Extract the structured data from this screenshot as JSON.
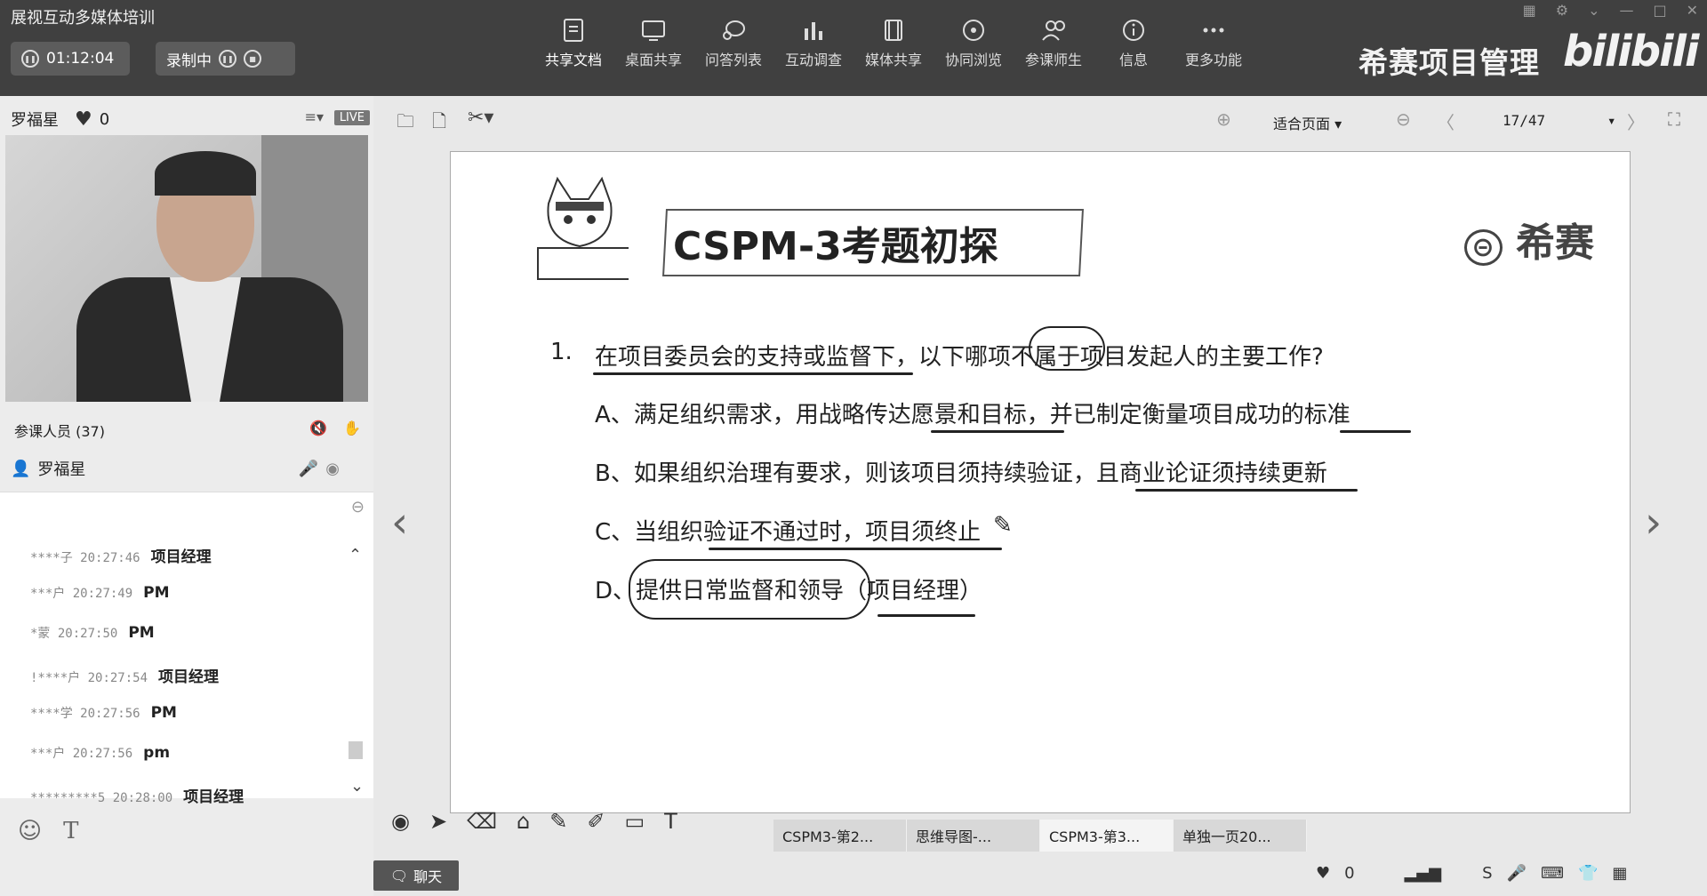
{
  "app": {
    "title": "展视互动多媒体培训"
  },
  "session": {
    "timer": "01:12:04",
    "rec_label": "录制中"
  },
  "toolbar": {
    "items": [
      {
        "label": "共享文档",
        "icon": "document-icon"
      },
      {
        "label": "桌面共享",
        "icon": "desktop-icon"
      },
      {
        "label": "问答列表",
        "icon": "qa-icon"
      },
      {
        "label": "互动调查",
        "icon": "chart-icon"
      },
      {
        "label": "媒体共享",
        "icon": "film-icon"
      },
      {
        "label": "协同浏览",
        "icon": "compass-icon"
      },
      {
        "label": "参课师生",
        "icon": "people-icon"
      },
      {
        "label": "信息",
        "icon": "info-icon"
      },
      {
        "label": "更多功能",
        "icon": "more-icon"
      }
    ]
  },
  "brand": {
    "name": "希赛项目管理",
    "bili": "bilibili"
  },
  "presenter": {
    "name": "罗福星",
    "likes": "0",
    "live": "LIVE"
  },
  "attendees": {
    "header": "参课人员 (37)",
    "first": "罗福星"
  },
  "chat": {
    "messages": [
      {
        "user": "****子",
        "time": "20:27:46",
        "text": "项目经理"
      },
      {
        "user": "***户",
        "time": "20:27:49",
        "text": "PM"
      },
      {
        "user": "*蒙",
        "time": "20:27:50",
        "text": "PM"
      },
      {
        "user": "!****户",
        "time": "20:27:54",
        "text": "项目经理"
      },
      {
        "user": "****学",
        "time": "20:27:56",
        "text": "PM"
      },
      {
        "user": "***户",
        "time": "20:27:56",
        "text": "pm"
      },
      {
        "user": "*********5",
        "time": "20:28:00",
        "text": "项目经理"
      }
    ],
    "tab_label": "聊天"
  },
  "doc": {
    "fit_label": "适合页面",
    "page": "17/47"
  },
  "slide": {
    "title": "CSPM-3考题初探",
    "logo": "希赛",
    "question_num": "1.",
    "question": "在项目委员会的支持或监督下，以下哪项不属于项目发起人的主要工作?",
    "options": {
      "a": "A、满足组织需求，用战略传达愿景和目标，并已制定衡量项目成功的标准",
      "b": "B、如果组织治理有要求，则该项目须持续验证，且商业论证须持续更新",
      "c": "C、当组织验证不通过时，项目须终止",
      "d": "D、提供日常监督和领导（项目经理）"
    }
  },
  "tabs": [
    {
      "label": "CSPM3-第2..."
    },
    {
      "label": "思维导图-..."
    },
    {
      "label": "CSPM3-第3..."
    },
    {
      "label": "单独一页20..."
    }
  ],
  "status": {
    "likes": "0"
  }
}
